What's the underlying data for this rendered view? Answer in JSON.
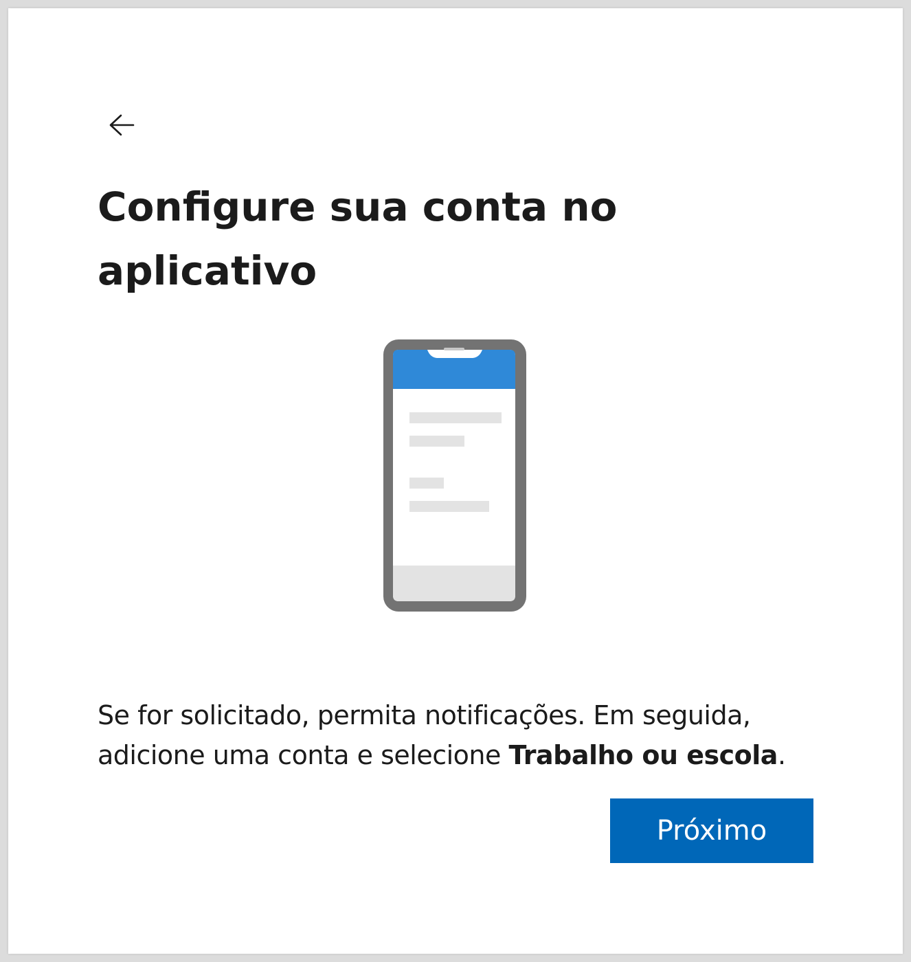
{
  "header": {
    "back_icon": "arrow-left-icon"
  },
  "title": "Configure sua conta no aplicativo",
  "illustration": {
    "icon": "smartphone-app-icon",
    "colors": {
      "frame": "#737373",
      "screen_header": "#2f89d8",
      "screen_body": "#ffffff",
      "placeholder_line": "#e3e3e3",
      "screen_footer": "#e3e3e3"
    }
  },
  "description": {
    "text_before": "Se for solicitado, permita notificações. Em seguida, adicione uma conta e selecione ",
    "bold": "Trabalho ou escola",
    "text_after": "."
  },
  "actions": {
    "next_label": "Próximo"
  },
  "colors": {
    "accent": "#0067b8",
    "text": "#1b1b1b",
    "background": "#ffffff"
  }
}
